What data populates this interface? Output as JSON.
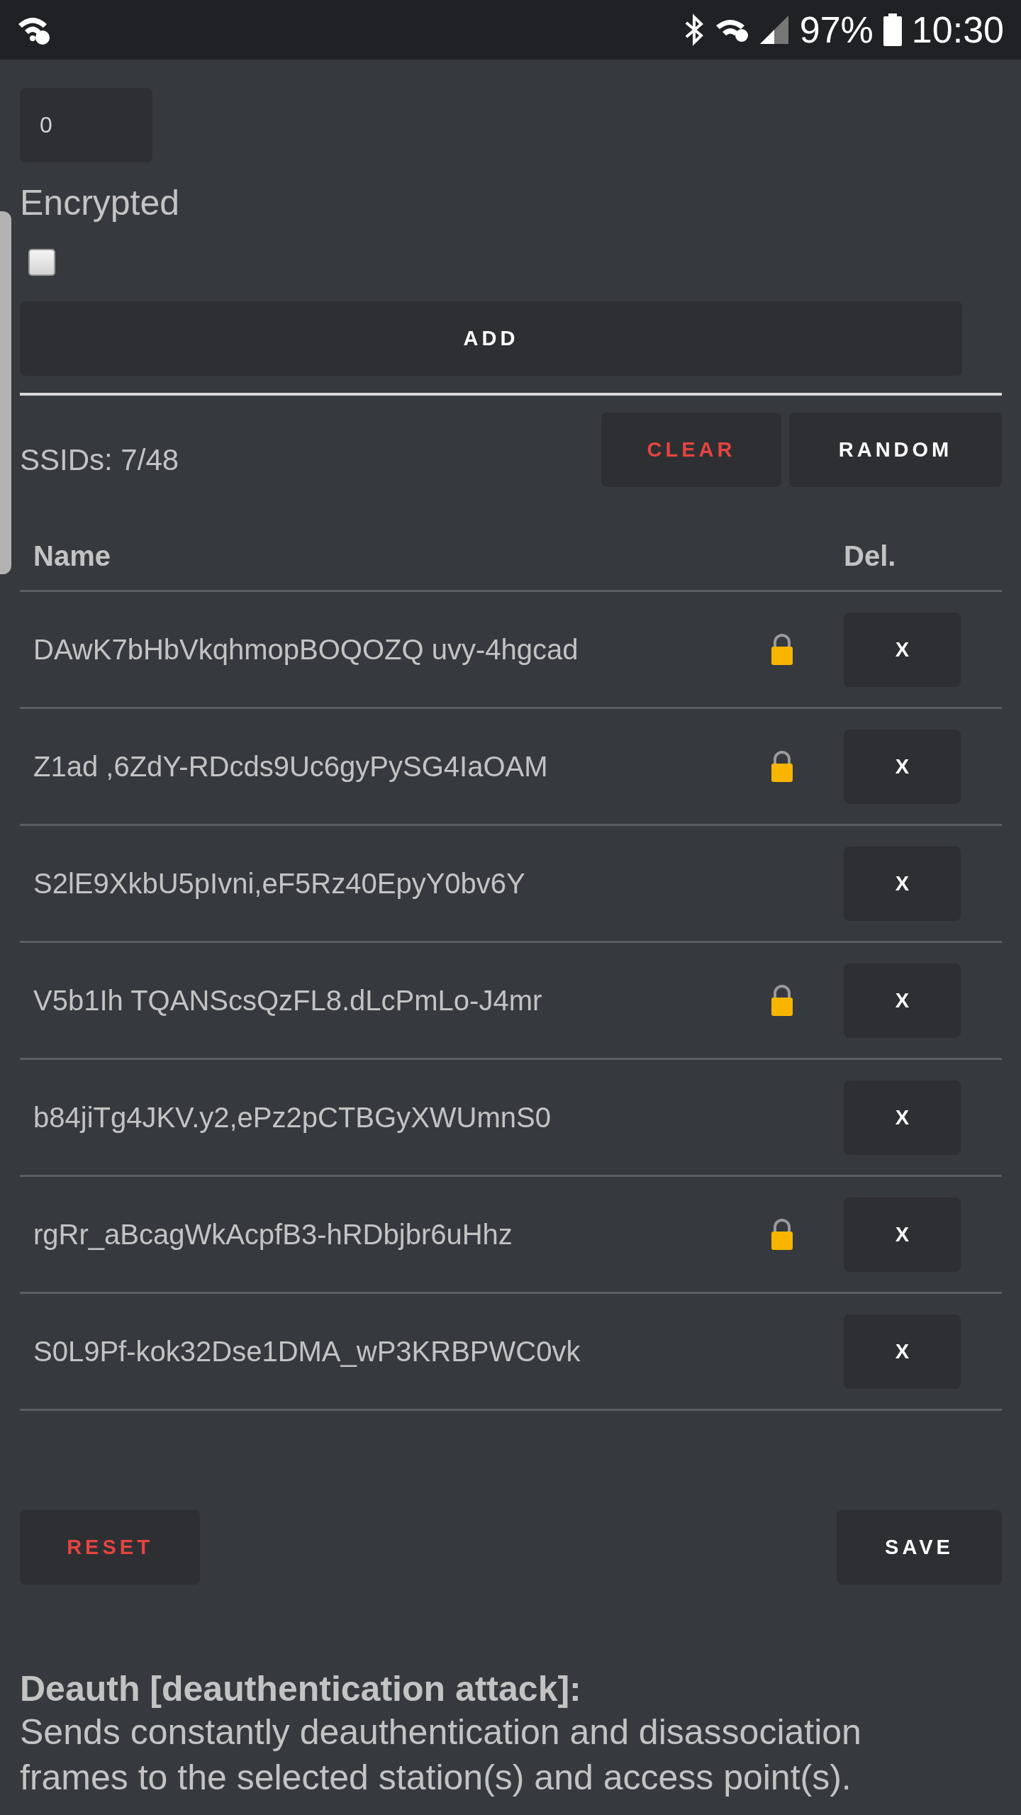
{
  "status_bar": {
    "battery": "97%",
    "time": "10:30"
  },
  "clones_field": {
    "value": "0"
  },
  "encrypted": {
    "label": "Encrypted",
    "checked": false
  },
  "add_button": "ADD",
  "ssid_count": "SSIDs: 7/48",
  "buttons": [
    {
      "label": "CLEAR",
      "kind": "danger"
    },
    {
      "label": "RANDOM",
      "kind": "normal"
    }
  ],
  "table": {
    "columns": [
      "Name",
      "Del."
    ],
    "rows": [
      {
        "name": "DAwK7bHbVkqhmopBOQOZQ uvy-4hgcad",
        "encrypted": true,
        "delete": "X"
      },
      {
        "name": "Z1ad ,6ZdY-RDcds9Uc6gyPySG4IaOAM",
        "encrypted": true,
        "delete": "X"
      },
      {
        "name": "S2lE9XkbU5pIvni,eF5Rz40EpyY0bv6Y",
        "encrypted": false,
        "delete": "X"
      },
      {
        "name": "V5b1Ih TQANScsQzFL8.dLcPmLo-J4mr",
        "encrypted": true,
        "delete": "X"
      },
      {
        "name": "b84jiTg4JKV.y2,ePz2pCTBGyXWUmnS0",
        "encrypted": false,
        "delete": "X"
      },
      {
        "name": "rgRr_aBcagWkAcpfB3-hRDbjbr6uHhz",
        "encrypted": true,
        "delete": "X"
      },
      {
        "name": "S0L9Pf-kok32Dse1DMA_wP3KRBPWC0vk",
        "encrypted": false,
        "delete": "X"
      }
    ]
  },
  "footer_buttons": [
    {
      "label": "RESET",
      "kind": "danger"
    },
    {
      "label": "SAVE",
      "kind": "normal"
    }
  ],
  "info": {
    "title": "Deauth [deauthentication attack]:",
    "text": "Sends constantly deauthentication and disassociation frames to the selected station(s) and access point(s)."
  }
}
